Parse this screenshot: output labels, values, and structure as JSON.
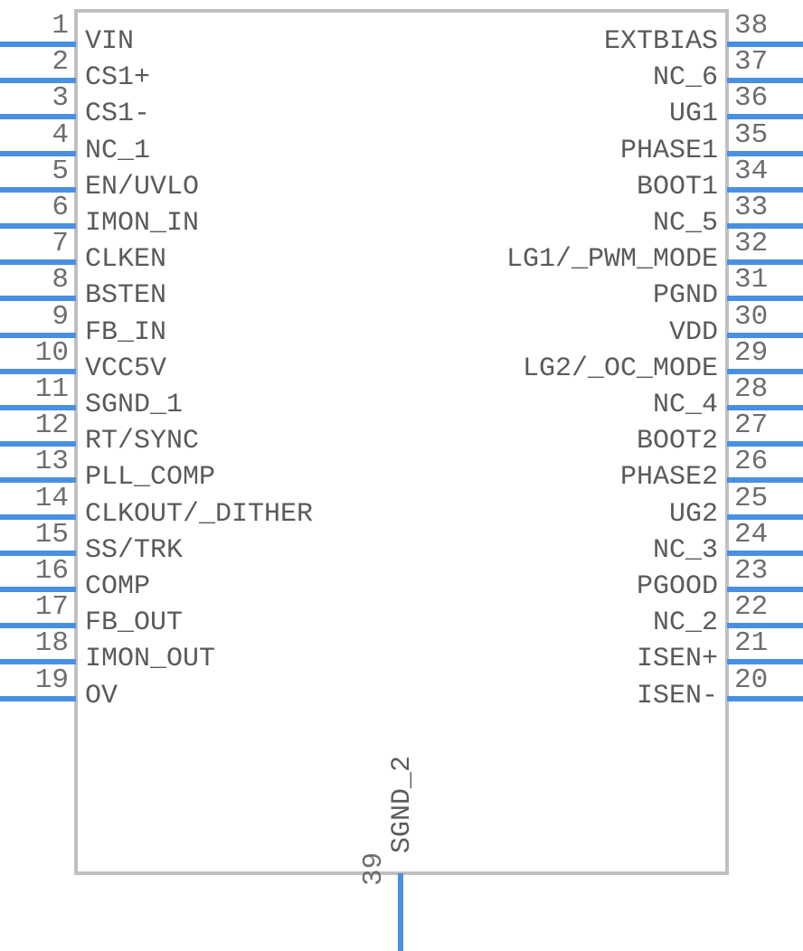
{
  "symbol": {
    "package_pin_count": 39,
    "colors": {
      "wire": "#4a90e2",
      "body_border": "#c0c0c0",
      "label_text": "#5a5a5a",
      "pin_number_text": "#6e6e6e",
      "background": "#ffffff"
    },
    "left_pins": [
      {
        "number": "1",
        "label": "VIN"
      },
      {
        "number": "2",
        "label": "CS1+"
      },
      {
        "number": "3",
        "label": "CS1-"
      },
      {
        "number": "4",
        "label": "NC_1"
      },
      {
        "number": "5",
        "label": "EN/UVLO"
      },
      {
        "number": "6",
        "label": "IMON_IN"
      },
      {
        "number": "7",
        "label": "CLKEN"
      },
      {
        "number": "8",
        "label": "BSTEN"
      },
      {
        "number": "9",
        "label": "FB_IN"
      },
      {
        "number": "10",
        "label": "VCC5V"
      },
      {
        "number": "11",
        "label": "SGND_1"
      },
      {
        "number": "12",
        "label": "RT/SYNC"
      },
      {
        "number": "13",
        "label": "PLL_COMP"
      },
      {
        "number": "14",
        "label": "CLKOUT/_DITHER"
      },
      {
        "number": "15",
        "label": "SS/TRK"
      },
      {
        "number": "16",
        "label": "COMP"
      },
      {
        "number": "17",
        "label": "FB_OUT"
      },
      {
        "number": "18",
        "label": "IMON_OUT"
      },
      {
        "number": "19",
        "label": "OV"
      }
    ],
    "right_pins": [
      {
        "number": "38",
        "label": "EXTBIAS"
      },
      {
        "number": "37",
        "label": "NC_6"
      },
      {
        "number": "36",
        "label": "UG1"
      },
      {
        "number": "35",
        "label": "PHASE1"
      },
      {
        "number": "34",
        "label": "BOOT1"
      },
      {
        "number": "33",
        "label": "NC_5"
      },
      {
        "number": "32",
        "label": "LG1/_PWM_MODE"
      },
      {
        "number": "31",
        "label": "PGND"
      },
      {
        "number": "30",
        "label": "VDD"
      },
      {
        "number": "29",
        "label": "LG2/_OC_MODE"
      },
      {
        "number": "28",
        "label": "NC_4"
      },
      {
        "number": "27",
        "label": "BOOT2"
      },
      {
        "number": "26",
        "label": "PHASE2"
      },
      {
        "number": "25",
        "label": "UG2"
      },
      {
        "number": "24",
        "label": "NC_3"
      },
      {
        "number": "23",
        "label": "PGOOD"
      },
      {
        "number": "22",
        "label": "NC_2"
      },
      {
        "number": "21",
        "label": "ISEN+"
      },
      {
        "number": "20",
        "label": "ISEN-"
      }
    ],
    "bottom_pins": [
      {
        "number": "39",
        "label": "SGND_2"
      }
    ]
  }
}
